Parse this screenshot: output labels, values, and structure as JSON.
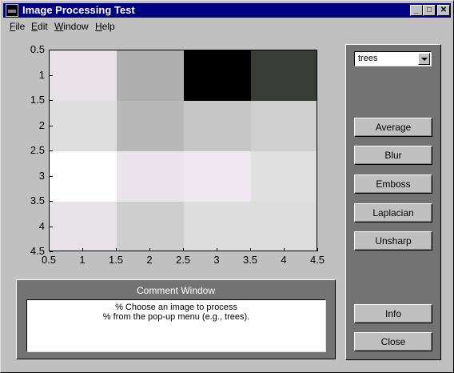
{
  "window": {
    "title": "Image Processing Test",
    "controls": {
      "minimize": "_",
      "maximize": "□",
      "close": "✕"
    }
  },
  "menu": [
    "File",
    "Edit",
    "Window",
    "Help"
  ],
  "chart_data": {
    "type": "heatmap",
    "colormap": "gray",
    "rows": 4,
    "cols": 4,
    "cells_gray_hex": [
      [
        "#e8e2e8",
        "#aeaeae",
        "#000000",
        "#3a3c38"
      ],
      [
        "#dedede",
        "#b8b8b8",
        "#c6c6c6",
        "#cfcfcf"
      ],
      [
        "#ffffff",
        "#ece4ec",
        "#f0e8f0",
        "#e0e0e0"
      ],
      [
        "#e6e2e6",
        "#cecece",
        "#dddddd",
        "#dcdcdc"
      ]
    ],
    "x_ticks": [
      "0.5",
      "1",
      "1.5",
      "2",
      "2.5",
      "3",
      "3.5",
      "4",
      "4.5"
    ],
    "y_ticks": [
      "0.5",
      "1",
      "1.5",
      "2",
      "2.5",
      "3",
      "3.5",
      "4",
      "4.5"
    ],
    "xlim": [
      0.5,
      4.5
    ],
    "ylim": [
      0.5,
      4.5
    ],
    "y_direction": "reverse"
  },
  "comment_window": {
    "title": "Comment Window",
    "lines": [
      "% Choose an image to process",
      "% from the pop-up menu (e.g., trees)."
    ]
  },
  "controls": {
    "image_select": {
      "value": "trees"
    },
    "buttons": [
      "Average",
      "Blur",
      "Emboss",
      "Laplacian",
      "Unsharp"
    ],
    "info_label": "Info",
    "close_label": "Close"
  },
  "colors": {
    "title_bar": "#000080",
    "panel": "#737373",
    "face": "#c0c0c0"
  }
}
